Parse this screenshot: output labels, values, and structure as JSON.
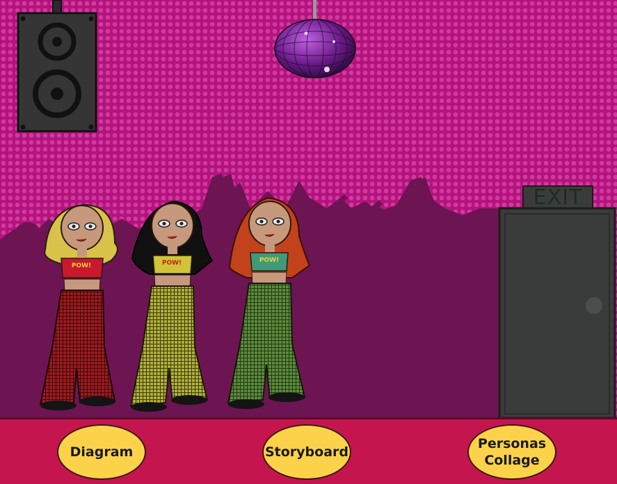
{
  "scene": {
    "exit_sign": "EXIT",
    "badge_text": "POW!",
    "colors": {
      "background": "#c4178c",
      "crowd": "#6d1452",
      "floor_bar": "#c5154f",
      "button_fill": "#fbd24a",
      "door": "#3a3c3c"
    }
  },
  "characters": [
    {
      "hair": "blonde",
      "hair_color": "#d8c24a",
      "top_color": "#c8192e",
      "pants_color": "#a01a1e"
    },
    {
      "hair": "black",
      "hair_color": "#101010",
      "top_color": "#d0c43a",
      "pants_color": "#b2b038"
    },
    {
      "hair": "red",
      "hair_color": "#c2421c",
      "top_color": "#3f9a7a",
      "pants_color": "#5e8a3a"
    }
  ],
  "nav": {
    "diagram": "Diagram",
    "storyboard": "Storyboard",
    "personas": "Personas\nCollage"
  }
}
